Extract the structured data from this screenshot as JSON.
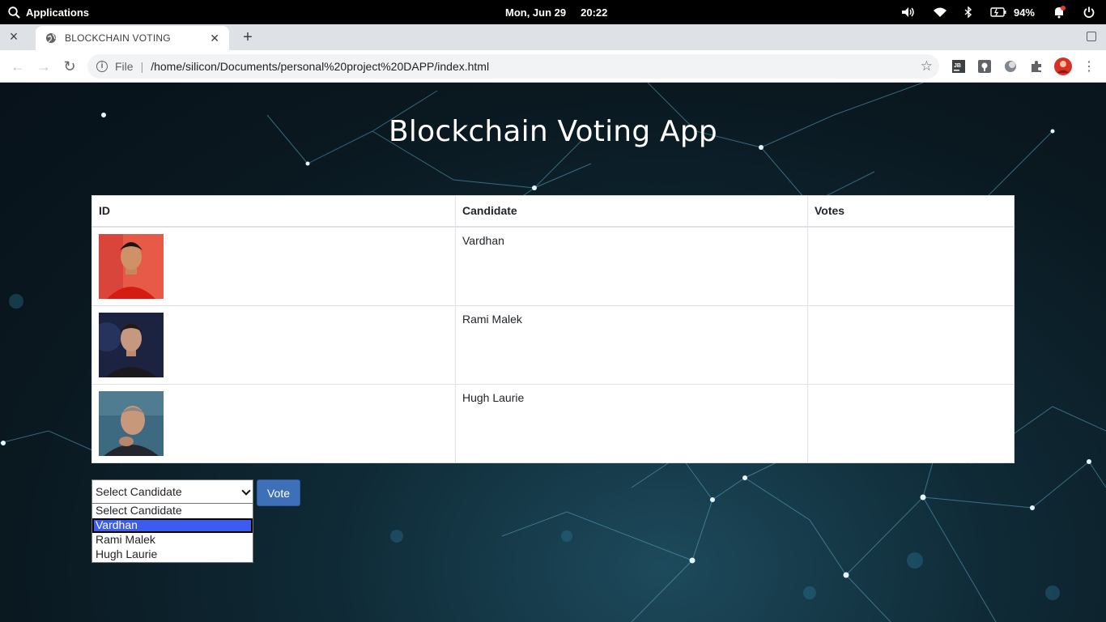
{
  "os": {
    "apps_label": "Applications",
    "date": "Mon, Jun 29",
    "time": "20:22",
    "battery": "94%"
  },
  "browser": {
    "tab_title": "BLOCKCHAIN VOTING",
    "scheme_label": "File",
    "url": "/home/silicon/Documents/personal%20project%20DAPP/index.html",
    "profile_color": "#d93025"
  },
  "page": {
    "title": "Blockchain Voting App",
    "table": {
      "headers": [
        "ID",
        "Candidate",
        "Votes"
      ],
      "rows": [
        {
          "candidate": "Vardhan",
          "votes": ""
        },
        {
          "candidate": "Rami Malek",
          "votes": ""
        },
        {
          "candidate": "Hugh Laurie",
          "votes": ""
        }
      ]
    },
    "select": {
      "value": "Select Candidate",
      "options": [
        "Select Candidate",
        "Vardhan",
        "Rami Malek",
        "Hugh Laurie"
      ],
      "highlighted": "Vardhan"
    },
    "vote_label": "Vote",
    "accent": "#3d70b8"
  }
}
